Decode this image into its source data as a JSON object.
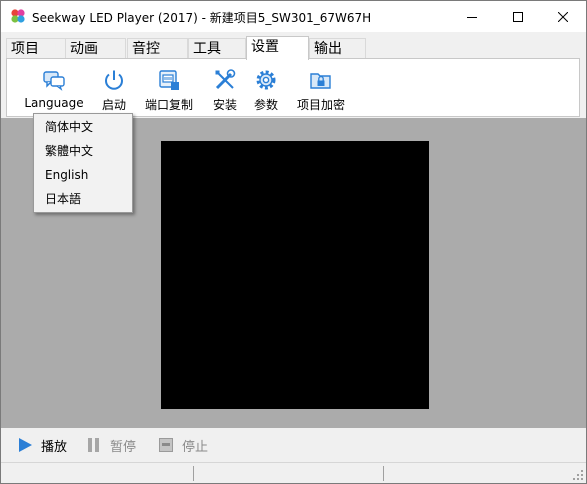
{
  "window": {
    "title": "Seekway LED Player  (2017)  -  新建项目5_SW301_67W67H"
  },
  "tabs": [
    {
      "label": "项目"
    },
    {
      "label": "动画"
    },
    {
      "label": "音控"
    },
    {
      "label": "工具"
    },
    {
      "label": "设置"
    },
    {
      "label": "输出"
    }
  ],
  "ribbon": {
    "language": {
      "label": "Language",
      "icon": "chat-bubbles-icon"
    },
    "startup": {
      "label": "启动",
      "icon": "power-icon"
    },
    "port_copy": {
      "label": "端口复制",
      "icon": "port-icon"
    },
    "install": {
      "label": "安装",
      "icon": "tools-icon"
    },
    "params": {
      "label": "参数",
      "icon": "gear-icon"
    },
    "encrypt": {
      "label": "项目加密",
      "icon": "folder-lock-icon"
    }
  },
  "language_menu": {
    "items": [
      {
        "label": "简体中文"
      },
      {
        "label": "繁體中文"
      },
      {
        "label": "English"
      },
      {
        "label": "日本語"
      }
    ]
  },
  "playback": {
    "play": {
      "label": "播放"
    },
    "pause": {
      "label": "暂停"
    },
    "stop": {
      "label": "停止"
    }
  },
  "colors": {
    "workspace_bg": "#ababab",
    "screen_bg": "#000000",
    "icon_blue": "#2b7fd6"
  }
}
